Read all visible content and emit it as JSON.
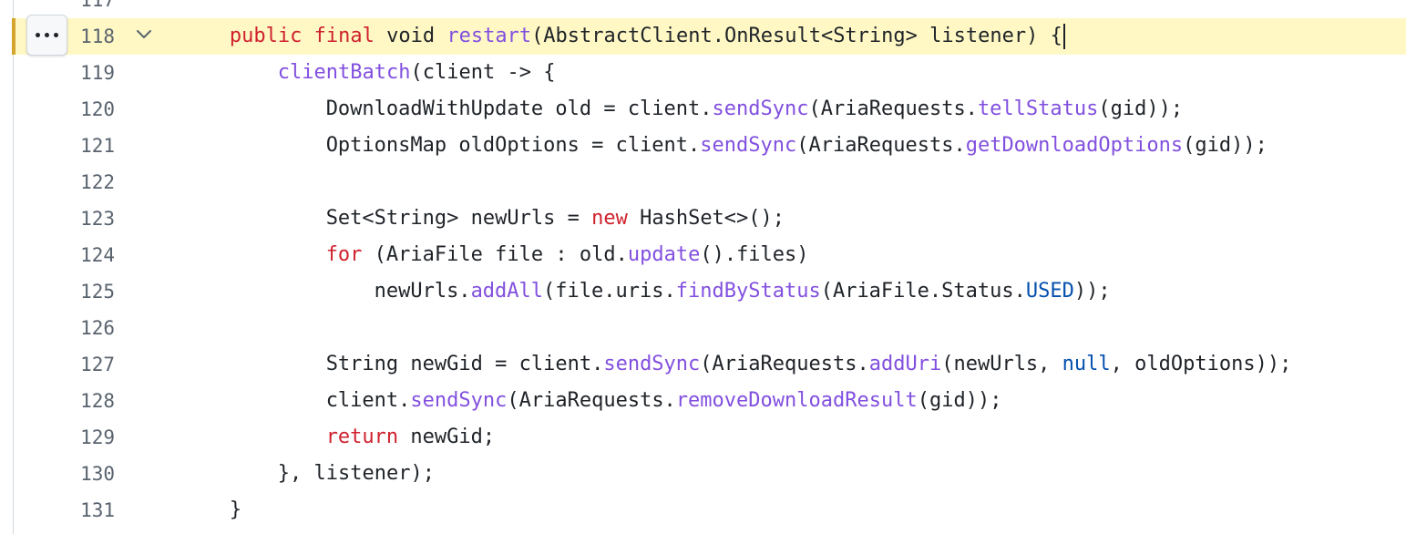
{
  "editor": {
    "highlighted_line": "118",
    "lines": [
      {
        "num": "117",
        "indent": 0,
        "tokens": []
      },
      {
        "num": "118",
        "indent": 1,
        "tokens": [
          {
            "t": "public",
            "c": "kw"
          },
          {
            "t": " "
          },
          {
            "t": "final",
            "c": "kw"
          },
          {
            "t": " void "
          },
          {
            "t": "restart",
            "c": "fn"
          },
          {
            "t": "(AbstractClient.OnResult<String> listener) {"
          }
        ]
      },
      {
        "num": "119",
        "indent": 2,
        "tokens": [
          {
            "t": "clientBatch",
            "c": "fn"
          },
          {
            "t": "(client -> {"
          }
        ]
      },
      {
        "num": "120",
        "indent": 3,
        "tokens": [
          {
            "t": "DownloadWithUpdate old = client."
          },
          {
            "t": "sendSync",
            "c": "fn"
          },
          {
            "t": "(AriaRequests."
          },
          {
            "t": "tellStatus",
            "c": "fn"
          },
          {
            "t": "(gid));"
          }
        ]
      },
      {
        "num": "121",
        "indent": 3,
        "tokens": [
          {
            "t": "OptionsMap oldOptions = client."
          },
          {
            "t": "sendSync",
            "c": "fn"
          },
          {
            "t": "(AriaRequests."
          },
          {
            "t": "getDownloadOptions",
            "c": "fn"
          },
          {
            "t": "(gid));"
          }
        ]
      },
      {
        "num": "122",
        "indent": 0,
        "tokens": []
      },
      {
        "num": "123",
        "indent": 3,
        "tokens": [
          {
            "t": "Set<String> newUrls = "
          },
          {
            "t": "new",
            "c": "kw"
          },
          {
            "t": " HashSet<>();"
          }
        ]
      },
      {
        "num": "124",
        "indent": 3,
        "tokens": [
          {
            "t": "for",
            "c": "kw"
          },
          {
            "t": " (AriaFile file : old."
          },
          {
            "t": "update",
            "c": "fn"
          },
          {
            "t": "().files)"
          }
        ]
      },
      {
        "num": "125",
        "indent": 4,
        "tokens": [
          {
            "t": "newUrls."
          },
          {
            "t": "addAll",
            "c": "fn"
          },
          {
            "t": "(file.uris."
          },
          {
            "t": "findByStatus",
            "c": "fn"
          },
          {
            "t": "(AriaFile.Status."
          },
          {
            "t": "USED",
            "c": "cst"
          },
          {
            "t": "));"
          }
        ]
      },
      {
        "num": "126",
        "indent": 0,
        "tokens": []
      },
      {
        "num": "127",
        "indent": 3,
        "tokens": [
          {
            "t": "String newGid = client."
          },
          {
            "t": "sendSync",
            "c": "fn"
          },
          {
            "t": "(AriaRequests."
          },
          {
            "t": "addUri",
            "c": "fn"
          },
          {
            "t": "(newUrls, "
          },
          {
            "t": "null",
            "c": "cst"
          },
          {
            "t": ", oldOptions));"
          }
        ]
      },
      {
        "num": "128",
        "indent": 3,
        "tokens": [
          {
            "t": "client."
          },
          {
            "t": "sendSync",
            "c": "fn"
          },
          {
            "t": "(AriaRequests."
          },
          {
            "t": "removeDownloadResult",
            "c": "fn"
          },
          {
            "t": "(gid));"
          }
        ]
      },
      {
        "num": "129",
        "indent": 3,
        "tokens": [
          {
            "t": "return",
            "c": "kw"
          },
          {
            "t": " newGid;"
          }
        ]
      },
      {
        "num": "130",
        "indent": 2,
        "tokens": [
          {
            "t": "}, listener);"
          }
        ]
      },
      {
        "num": "131",
        "indent": 1,
        "tokens": [
          {
            "t": "}"
          }
        ]
      }
    ]
  },
  "icons": {
    "more": "kebab-horizontal-icon",
    "fold": "chevron-down-icon"
  },
  "colors": {
    "keyword": "#cf222e",
    "function": "#8250df",
    "constant": "#0550ae",
    "text": "#1f2328",
    "line_number": "#59636e",
    "highlight_bg": "#fff8c5",
    "highlight_bar": "#d4a72c"
  }
}
